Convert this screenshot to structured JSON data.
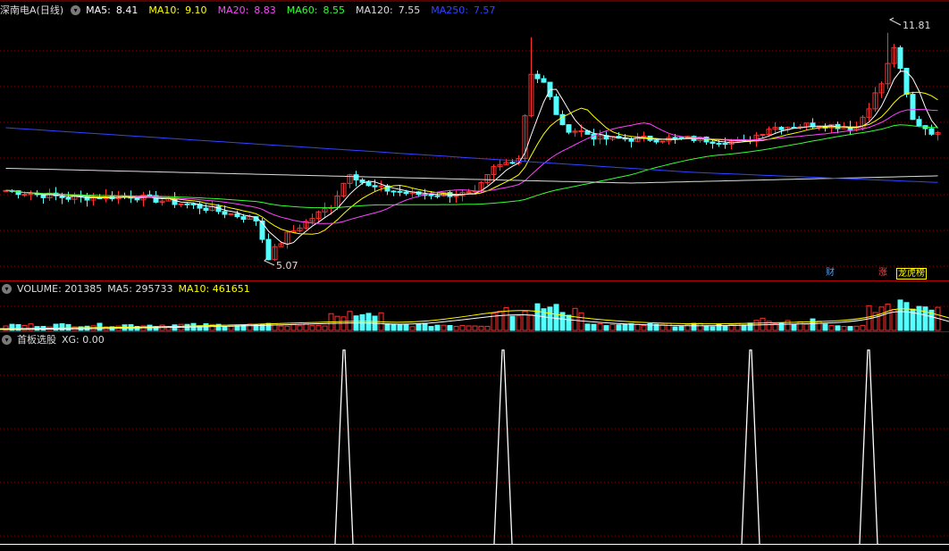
{
  "price_panel": {
    "title": "深南电A(日线)",
    "ma": [
      {
        "label": "MA5:",
        "value": "8.41",
        "color": "#ffffff"
      },
      {
        "label": "MA10:",
        "value": "9.10",
        "color": "#ffff00"
      },
      {
        "label": "MA20:",
        "value": "8.83",
        "color": "#ff44ff"
      },
      {
        "label": "MA60:",
        "value": "8.55",
        "color": "#33ff33"
      },
      {
        "label": "MA120:",
        "value": "7.55",
        "color": "#dddddd"
      },
      {
        "label": "MA250:",
        "value": "7.57",
        "color": "#3344ff"
      }
    ],
    "high_label": "11.81",
    "low_label": "5.07",
    "tags": [
      {
        "text": "财",
        "color": "#4aa3ff"
      },
      {
        "text": "涨",
        "color": "#ff4444"
      },
      {
        "text": "龙虎榜",
        "color": "#ffff00"
      }
    ]
  },
  "volume_panel": {
    "label": "VOLUME: 201385",
    "ma5": "MA5: 295733",
    "ma10": "MA10: 461651"
  },
  "indicator_panel": {
    "name": "首板选股",
    "value": "XG: 0.00"
  },
  "chart_data": {
    "type": "candlestick",
    "price_range": [
      5.07,
      11.81
    ],
    "signal_count": 4,
    "up_color": "#ff3030",
    "down_color": "#54ffff",
    "grid_color": "#8b0000"
  }
}
